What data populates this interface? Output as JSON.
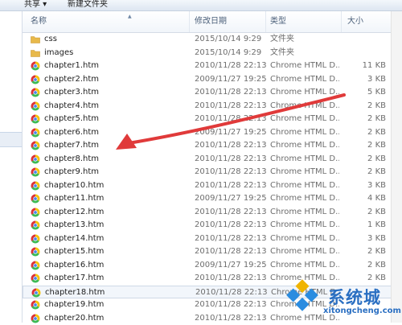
{
  "toolbar": {
    "share_label": "共享 ▾",
    "new_folder_label": "新建文件夹"
  },
  "header": {
    "name": "名称",
    "date": "修改日期",
    "type": "类型",
    "size": "大小"
  },
  "rows": [
    {
      "name": "css",
      "date": "2015/10/14 9:29",
      "type": "文件夹",
      "size": "",
      "kind": "folder"
    },
    {
      "name": "images",
      "date": "2015/10/14 9:29",
      "type": "文件夹",
      "size": "",
      "kind": "folder"
    },
    {
      "name": "chapter1.htm",
      "date": "2010/11/28 22:13",
      "type": "Chrome HTML D...",
      "size": "11 KB",
      "kind": "chrome"
    },
    {
      "name": "chapter2.htm",
      "date": "2009/11/27 19:25",
      "type": "Chrome HTML D...",
      "size": "3 KB",
      "kind": "chrome"
    },
    {
      "name": "chapter3.htm",
      "date": "2010/11/28 22:13",
      "type": "Chrome HTML D...",
      "size": "5 KB",
      "kind": "chrome"
    },
    {
      "name": "chapter4.htm",
      "date": "2010/11/28 22:13",
      "type": "Chrome HTML D...",
      "size": "2 KB",
      "kind": "chrome"
    },
    {
      "name": "chapter5.htm",
      "date": "2010/11/28 22:13",
      "type": "Chrome HTML D...",
      "size": "2 KB",
      "kind": "chrome"
    },
    {
      "name": "chapter6.htm",
      "date": "2009/11/27 19:25",
      "type": "Chrome HTML D...",
      "size": "2 KB",
      "kind": "chrome"
    },
    {
      "name": "chapter7.htm",
      "date": "2010/11/28 22:13",
      "type": "Chrome HTML D...",
      "size": "2 KB",
      "kind": "chrome"
    },
    {
      "name": "chapter8.htm",
      "date": "2010/11/28 22:13",
      "type": "Chrome HTML D...",
      "size": "2 KB",
      "kind": "chrome"
    },
    {
      "name": "chapter9.htm",
      "date": "2010/11/28 22:13",
      "type": "Chrome HTML D...",
      "size": "2 KB",
      "kind": "chrome"
    },
    {
      "name": "chapter10.htm",
      "date": "2010/11/28 22:13",
      "type": "Chrome HTML D...",
      "size": "3 KB",
      "kind": "chrome"
    },
    {
      "name": "chapter11.htm",
      "date": "2009/11/27 19:25",
      "type": "Chrome HTML D...",
      "size": "4 KB",
      "kind": "chrome"
    },
    {
      "name": "chapter12.htm",
      "date": "2010/11/28 22:13",
      "type": "Chrome HTML D...",
      "size": "2 KB",
      "kind": "chrome"
    },
    {
      "name": "chapter13.htm",
      "date": "2010/11/28 22:13",
      "type": "Chrome HTML D...",
      "size": "1 KB",
      "kind": "chrome"
    },
    {
      "name": "chapter14.htm",
      "date": "2010/11/28 22:13",
      "type": "Chrome HTML D...",
      "size": "3 KB",
      "kind": "chrome"
    },
    {
      "name": "chapter15.htm",
      "date": "2010/11/28 22:13",
      "type": "Chrome HTML D...",
      "size": "2 KB",
      "kind": "chrome"
    },
    {
      "name": "chapter16.htm",
      "date": "2009/11/27 19:25",
      "type": "Chrome HTML D...",
      "size": "2 KB",
      "kind": "chrome"
    },
    {
      "name": "chapter17.htm",
      "date": "2010/11/28 22:13",
      "type": "Chrome HTML D...",
      "size": "2 KB",
      "kind": "chrome"
    },
    {
      "name": "chapter18.htm",
      "date": "2010/11/28 22:13",
      "type": "Chrome HTML D...",
      "size": "",
      "kind": "chrome",
      "selected": true
    },
    {
      "name": "chapter19.htm",
      "date": "2010/11/28 22:13",
      "type": "Chrome HTML D...",
      "size": "",
      "kind": "chrome"
    },
    {
      "name": "chapter20.htm",
      "date": "2010/11/28 22:13",
      "type": "Chrome HTML D...",
      "size": "",
      "kind": "chrome"
    }
  ],
  "watermark": {
    "text": "系统城",
    "url": "xitongcheng.com"
  },
  "colors": {
    "arrow": "#e03a3a",
    "folder": "#e8b94a",
    "watermark": "#2a6fc2"
  }
}
